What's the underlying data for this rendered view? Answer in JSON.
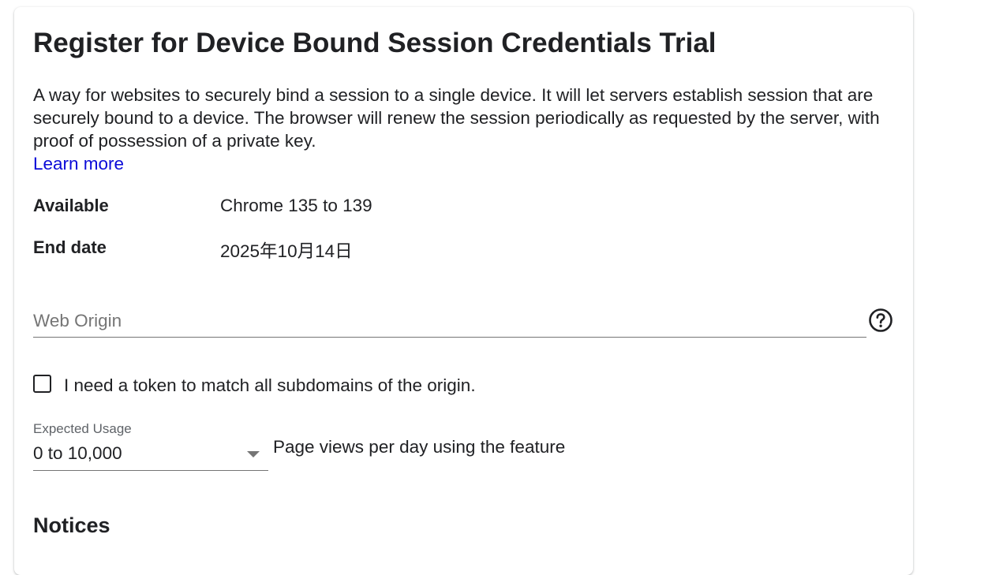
{
  "form": {
    "title": "Register for Device Bound Session Credentials Trial",
    "description": "A way for websites to securely bind a session to a single device. It will let servers establish session that are securely bound to a device. The browser will renew the session periodically as requested by the server, with proof of possession of a private key.",
    "learn_more": "Learn more",
    "available": {
      "label": "Available",
      "value": "Chrome 135 to 139"
    },
    "end_date": {
      "label": "End date",
      "value": "2025年10月14日"
    },
    "web_origin": {
      "placeholder": "Web Origin",
      "value": "",
      "help_icon": "help-circle-icon"
    },
    "subdomains_checkbox": {
      "label": "I need a token to match all subdomains of the origin.",
      "checked": false
    },
    "expected_usage": {
      "caption": "Expected Usage",
      "selected": "0 to 10,000",
      "suffix": "Page views per day using the feature",
      "icon": "dropdown-arrow-icon"
    },
    "notices_heading": "Notices"
  },
  "colors": {
    "link": "#0b0bd8",
    "text": "#202124",
    "placeholder": "#757575",
    "underline": "#757575"
  }
}
